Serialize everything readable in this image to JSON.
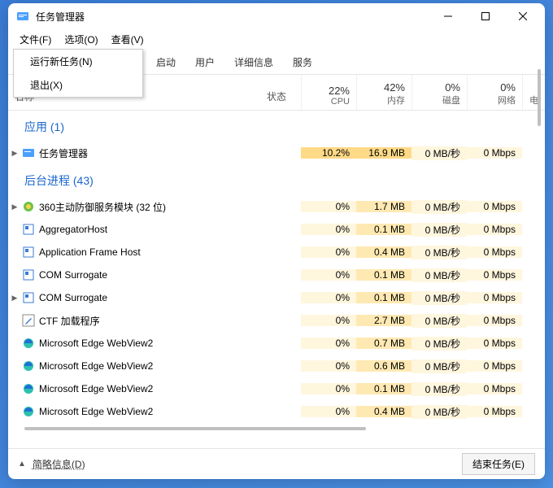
{
  "title": "任务管理器",
  "menubar": {
    "file": "文件(F)",
    "options": "选项(O)",
    "view": "查看(V)"
  },
  "dropdown": {
    "run": "运行新任务(N)",
    "exit": "退出(X)"
  },
  "tabs": {
    "startup": "启动",
    "users": "用户",
    "details": "详细信息",
    "services": "服务"
  },
  "header": {
    "name": "名称",
    "status": "状态",
    "cpu_pct": "22%",
    "cpu": "CPU",
    "mem_pct": "42%",
    "mem": "内存",
    "disk_pct": "0%",
    "disk": "磁盘",
    "net_pct": "0%",
    "net": "网络",
    "power": "电"
  },
  "sections": {
    "apps": "应用 (1)",
    "bg": "后台进程 (43)"
  },
  "rows": {
    "taskmgr": {
      "name": "任务管理器",
      "cpu": "10.2%",
      "mem": "16.9 MB",
      "disk": "0 MB/秒",
      "net": "0 Mbps"
    },
    "r360": {
      "name": "360主动防御服务模块 (32 位)",
      "cpu": "0%",
      "mem": "1.7 MB",
      "disk": "0 MB/秒",
      "net": "0 Mbps"
    },
    "agg": {
      "name": "AggregatorHost",
      "cpu": "0%",
      "mem": "0.1 MB",
      "disk": "0 MB/秒",
      "net": "0 Mbps"
    },
    "afh": {
      "name": "Application Frame Host",
      "cpu": "0%",
      "mem": "0.4 MB",
      "disk": "0 MB/秒",
      "net": "0 Mbps"
    },
    "com1": {
      "name": "COM Surrogate",
      "cpu": "0%",
      "mem": "0.1 MB",
      "disk": "0 MB/秒",
      "net": "0 Mbps"
    },
    "com2": {
      "name": "COM Surrogate",
      "cpu": "0%",
      "mem": "0.1 MB",
      "disk": "0 MB/秒",
      "net": "0 Mbps"
    },
    "ctf": {
      "name": "CTF 加载程序",
      "cpu": "0%",
      "mem": "2.7 MB",
      "disk": "0 MB/秒",
      "net": "0 Mbps"
    },
    "edge1": {
      "name": "Microsoft Edge WebView2",
      "cpu": "0%",
      "mem": "0.7 MB",
      "disk": "0 MB/秒",
      "net": "0 Mbps"
    },
    "edge2": {
      "name": "Microsoft Edge WebView2",
      "cpu": "0%",
      "mem": "0.6 MB",
      "disk": "0 MB/秒",
      "net": "0 Mbps"
    },
    "edge3": {
      "name": "Microsoft Edge WebView2",
      "cpu": "0%",
      "mem": "0.1 MB",
      "disk": "0 MB/秒",
      "net": "0 Mbps"
    },
    "edge4": {
      "name": "Microsoft Edge WebView2",
      "cpu": "0%",
      "mem": "0.4 MB",
      "disk": "0 MB/秒",
      "net": "0 Mbps"
    }
  },
  "footer": {
    "fewer": "简略信息(D)",
    "end": "结束任务(E)"
  }
}
